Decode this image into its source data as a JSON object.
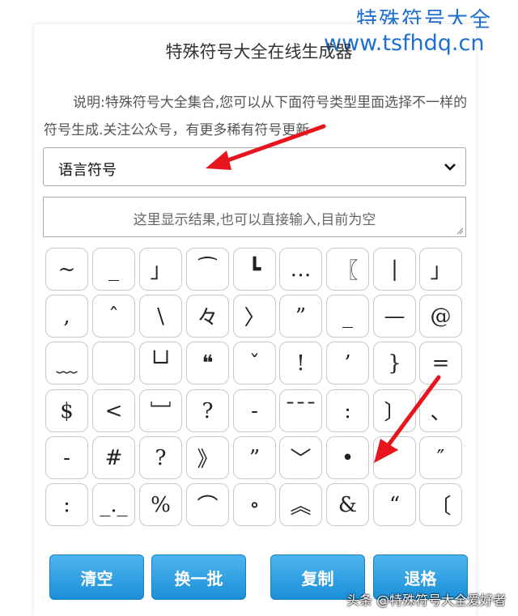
{
  "watermark": {
    "title": "特殊符号大全",
    "url": "www.tsfhdq.cn"
  },
  "page": {
    "title": "特殊符号大全在线生成器",
    "description": "说明:特殊符号大全集合,您可以从下面符号类型里面选择不一样的符号生成.关注公众号，有更多稀有符号更新"
  },
  "select": {
    "value": "语言符号"
  },
  "result": {
    "placeholder": "这里显示结果,也可以直接输入,目前为空"
  },
  "symbols": [
    [
      "~",
      "_",
      "」",
      "⁀",
      "┗",
      "…",
      "〖",
      "|",
      "」"
    ],
    [
      ",",
      "ˆ",
      "\\",
      "々",
      "〉",
      "”",
      "_",
      "—",
      "@"
    ],
    [
      "﹏",
      "",
      "└┘",
      "❝",
      "ˇ",
      "!",
      "’",
      "}",
      "="
    ],
    [
      "$",
      "<",
      "﹈",
      "?",
      "-",
      "¯¯¯",
      ":",
      "〕",
      "、"
    ],
    [
      "-",
      "#",
      "?",
      "》",
      "”",
      "﹀",
      "•",
      "¯",
      "″"
    ],
    [
      ":",
      "_._",
      "%",
      "⌒",
      "∘",
      "︽",
      "&",
      "“",
      "〔"
    ]
  ],
  "buttons": {
    "clear": "清空",
    "next_batch": "换一批",
    "copy": "复制",
    "backspace": "退格"
  },
  "credit": "头条 @特殊符号大全爱好者",
  "colors": {
    "accent": "#1e8fd8",
    "arrow": "#e8141e",
    "watermark": "#1e6fd0"
  }
}
